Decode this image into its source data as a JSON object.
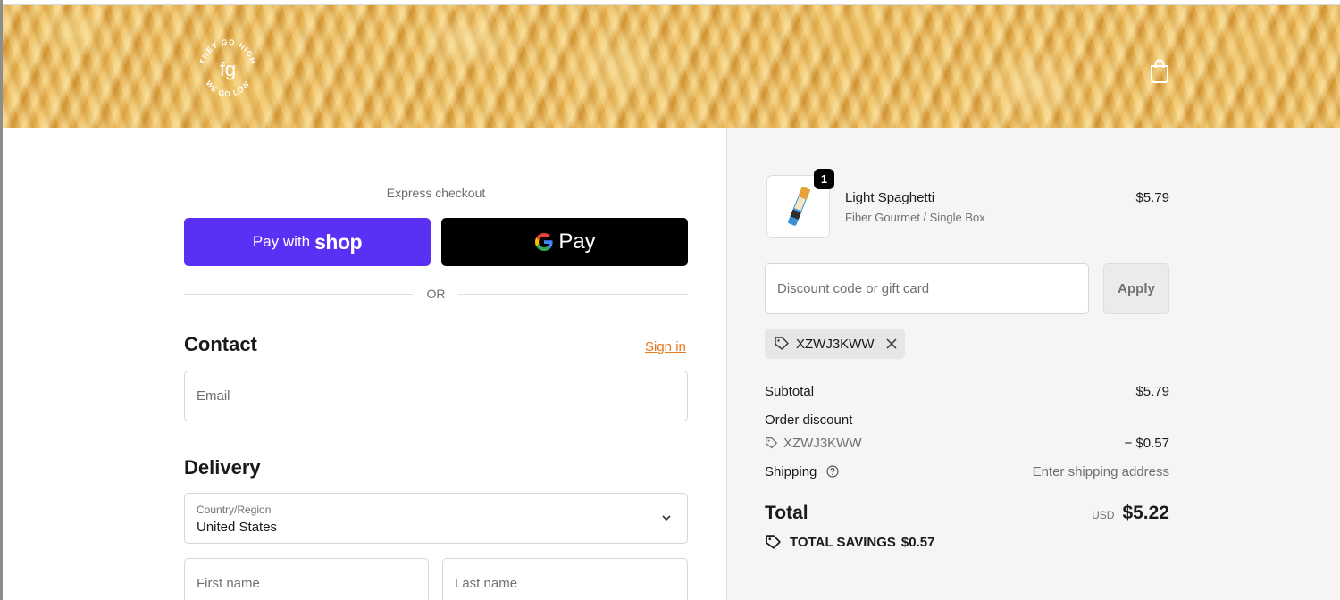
{
  "header": {
    "logo_top_text": "THEY GO HIGH",
    "logo_bottom_text": "WE GO LOW",
    "logo_mark": "fg",
    "cart_icon": "shopping-bag-icon"
  },
  "express": {
    "label": "Express checkout",
    "shop_pay": {
      "prefix": "Pay with",
      "brand": "shop"
    },
    "google_pay": {
      "label": "Pay"
    },
    "or": "OR"
  },
  "contact": {
    "title": "Contact",
    "sign_in": "Sign in",
    "email_placeholder": "Email"
  },
  "delivery": {
    "title": "Delivery",
    "country_label": "Country/Region",
    "country_value": "United States",
    "first_name_placeholder": "First name",
    "last_name_placeholder": "Last name"
  },
  "cart": {
    "quantity": "1",
    "product_name": "Light Spaghetti",
    "variant": "Fiber Gourmet / Single Box",
    "price": "$5.79"
  },
  "discount": {
    "placeholder": "Discount code or gift card",
    "apply": "Apply",
    "applied_code": "XZWJ3KWW"
  },
  "totals": {
    "subtotal_label": "Subtotal",
    "subtotal_value": "$5.79",
    "order_discount_label": "Order discount",
    "discount_code": "XZWJ3KWW",
    "discount_value": "− $0.57",
    "shipping_label": "Shipping",
    "shipping_value": "Enter shipping address",
    "total_label": "Total",
    "currency": "USD",
    "total_value": "$5.22",
    "savings_label": "TOTAL SAVINGS",
    "savings_value": "$0.57"
  },
  "colors": {
    "shop_pay": "#5a31f4",
    "google_pay": "#000000",
    "sign_in_link": "#e8781a",
    "summary_bg": "#f5f5f5"
  }
}
